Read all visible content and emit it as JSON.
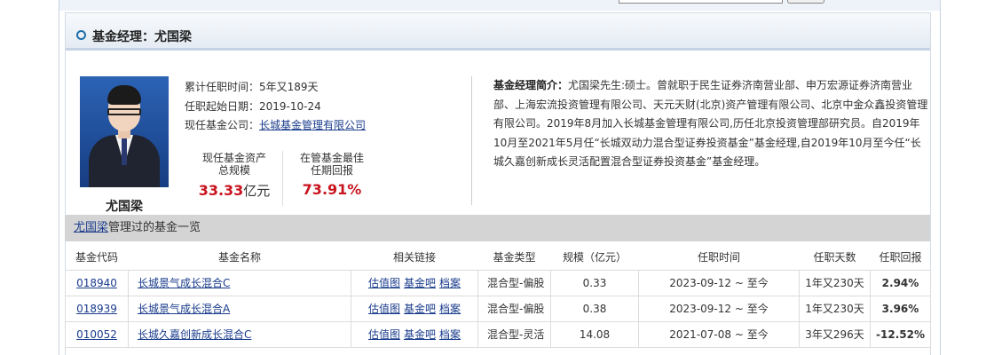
{
  "card_title": "基金经理：尤国梁",
  "manager": {
    "name": "尤国梁",
    "tenure_label": "累计任职时间：",
    "tenure_value": "5年又189天",
    "start_label": "任职起始日期：",
    "start_value": "2019-10-24",
    "company_label": "现任基金公司：",
    "company_value": "长城基金管理有限公司",
    "asset_label_1": "现任基金资产",
    "asset_label_2": "总规模",
    "asset_value": "33.33",
    "asset_unit": "亿元",
    "best_label_1": "在管基金最佳",
    "best_label_2": "任期回报",
    "best_value": "73.91%"
  },
  "bio": {
    "label": "基金经理简介：",
    "text": "尤国梁先生:硕士。曾就职于民生证券济南营业部、申万宏源证券济南营业部、上海宏流投资管理有限公司、天元天财(北京)资产管理有限公司、北京中金众鑫投资管理有限公司。2019年8月加入长城基金管理有限公司,历任北京投资管理部研究员。自2019年10月至2021年5月任“长城双动力混合型证券投资基金”基金经理,自2019年10月至今任“长城久嘉创新成长灵活配置混合型证券投资基金”基金经理。"
  },
  "list": {
    "manager_link": "尤国梁",
    "title_suffix": "管理过的基金一览",
    "columns": [
      "基金代码",
      "基金名称",
      "相关链接",
      "基金类型",
      "规模（亿元）",
      "任职时间",
      "任职天数",
      "任职回报"
    ],
    "rows": [
      {
        "code": "018940",
        "name": "长城景气成长混合C",
        "link1": "估值图",
        "link2": "基金吧",
        "link3": "档案",
        "type": "混合型-偏股",
        "size": "0.33",
        "period": "2023-09-12 ~ 至今",
        "days": "1年又230天",
        "ret": "2.94%"
      },
      {
        "code": "018939",
        "name": "长城景气成长混合A",
        "link1": "估值图",
        "link2": "基金吧",
        "link3": "档案",
        "type": "混合型-偏股",
        "size": "0.38",
        "period": "2023-09-12 ~ 至今",
        "days": "1年又230天",
        "ret": "3.96%"
      },
      {
        "code": "010052",
        "name": "长城久嘉创新成长混合C",
        "link1": "估值图",
        "link2": "基金吧",
        "link3": "档案",
        "type": "混合型-灵活",
        "size": "14.08",
        "period": "2021-07-08 ~ 至今",
        "days": "3年又296天",
        "ret": "-12.52%"
      }
    ]
  },
  "colors": {
    "return_positive": "#c8141e",
    "return_negative": "#0a8a2a",
    "link": "#1a3c8c"
  }
}
